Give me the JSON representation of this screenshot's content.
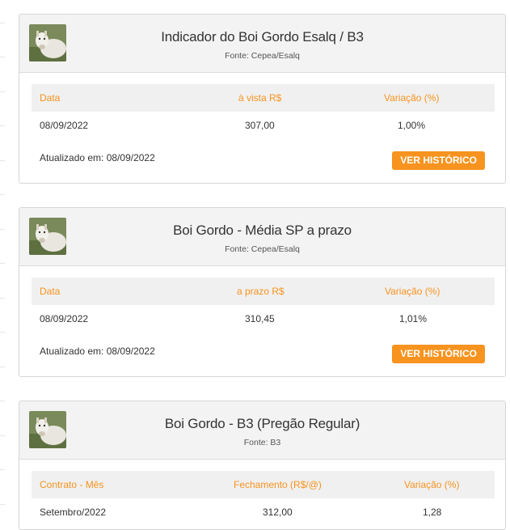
{
  "cards": [
    {
      "title": "Indicador do Boi Gordo Esalq / B3",
      "source": "Fonte: Cepea/Esalq",
      "headers": [
        "Data",
        "à vista R$",
        "Variação (%)"
      ],
      "row": [
        "08/09/2022",
        "307,00",
        "1,00%"
      ],
      "updated": "Atualizado em: 08/09/2022",
      "button": "VER HISTÓRICO"
    },
    {
      "title": "Boi Gordo - Média SP a prazo",
      "source": "Fonte: Cepea/Esalq",
      "headers": [
        "Data",
        "a prazo R$",
        "Variação (%)"
      ],
      "row": [
        "08/09/2022",
        "310,45",
        "1,01%"
      ],
      "updated": "Atualizado em: 08/09/2022",
      "button": "VER HISTÓRICO"
    },
    {
      "title": "Boi Gordo - B3 (Pregão Regular)",
      "source": "Fonte: B3",
      "headers": [
        "Contrato - Mês",
        "Fechamento (R$/@)",
        "Variação (%)"
      ],
      "row": [
        "Setembro/2022",
        "312,00",
        "1,28"
      ]
    }
  ],
  "colors": {
    "accent": "#f7931e",
    "header_bg": "#f3f3f3",
    "table_head_bg": "#f0f0f0"
  },
  "icons": {
    "thumbnail": "cattle-photo-icon"
  }
}
